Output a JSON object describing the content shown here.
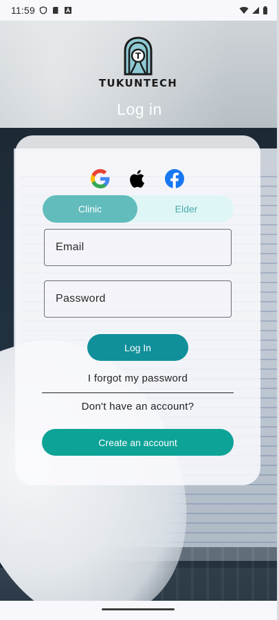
{
  "status_bar": {
    "time": "11:59",
    "left_icons": [
      "shield-icon",
      "sd-card-icon",
      "a-badge-icon"
    ],
    "right_icons": [
      "wifi-icon",
      "signal-icon",
      "battery-icon"
    ]
  },
  "logo": {
    "brand": "TUKUNTECH",
    "mark_letter": "T",
    "colors": {
      "mark_fill": "#8ec9d3",
      "mark_outline": "#1b1b1b"
    }
  },
  "page": {
    "title": "Log in"
  },
  "social": {
    "icons": [
      "google-icon",
      "apple-icon",
      "facebook-icon"
    ]
  },
  "tabs": {
    "items": [
      {
        "label": "Clinic",
        "selected": true
      },
      {
        "label": "Elder",
        "selected": false
      }
    ]
  },
  "form": {
    "email_placeholder": "Email",
    "password_placeholder": "Password"
  },
  "actions": {
    "login_label": "Log In",
    "forgot_label": "I forgot my password",
    "no_account_label": "Don't have an account?",
    "create_label": "Create an account"
  },
  "colors": {
    "tab_selected": "#62bcbc",
    "tab_track": "#dff6f6",
    "login_button": "#11909a",
    "create_button": "#0ea397"
  }
}
